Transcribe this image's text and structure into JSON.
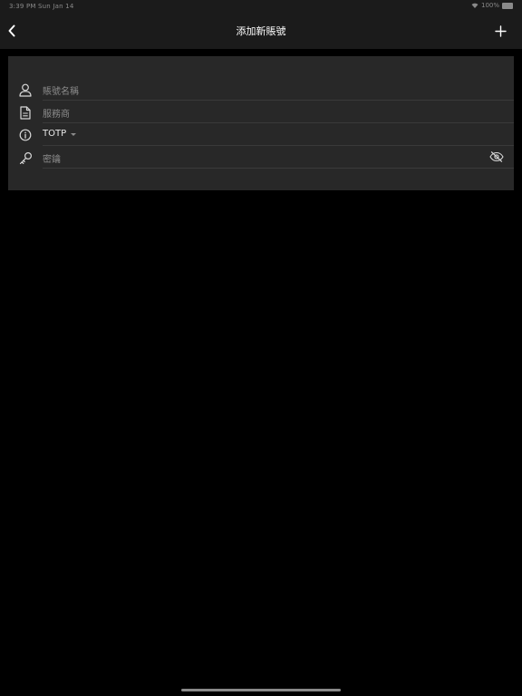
{
  "status_bar": {
    "time_date": "3:39 PM   Sun Jan 14",
    "battery": "100%"
  },
  "nav": {
    "title": "添加新賬號",
    "back_icon": "chevron-left-icon",
    "add_icon": "plus-icon"
  },
  "form": {
    "account_name_placeholder": "賬號名稱",
    "provider_placeholder": "服務商",
    "type_value": "TOTP",
    "secret_placeholder": "密鑰"
  },
  "colors": {
    "background": "#000000",
    "bar": "#1b1b1b",
    "card": "#282828",
    "placeholder": "#8c8c8c"
  }
}
